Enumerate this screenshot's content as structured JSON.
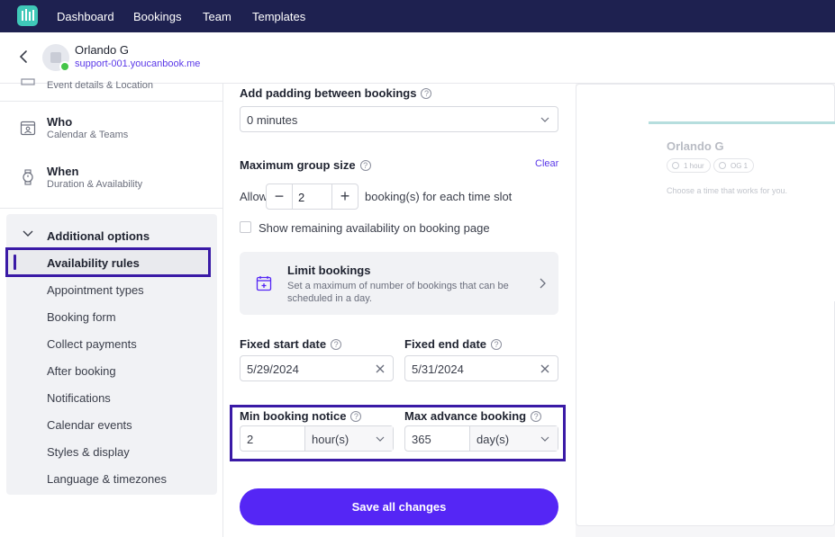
{
  "topbar": {
    "nav": [
      "Dashboard",
      "Bookings",
      "Team",
      "Templates"
    ]
  },
  "header": {
    "user_name": "Orlando G",
    "user_url": "support-001.youcanbook.me"
  },
  "sidebar": {
    "event_sub": "Event details & Location",
    "who": {
      "title": "Who",
      "sub": "Calendar & Teams"
    },
    "when": {
      "title": "When",
      "sub": "Duration & Availability"
    },
    "additional": {
      "title": "Additional options",
      "items": [
        "Availability rules",
        "Appointment types",
        "Booking form",
        "Collect payments",
        "After booking",
        "Notifications",
        "Calendar events",
        "Styles & display",
        "Language & timezones"
      ]
    }
  },
  "form": {
    "padding_label": "Add padding between bookings",
    "padding_value": "0 minutes",
    "group_label": "Maximum group size",
    "clear_label": "Clear",
    "allow_label": "Allow",
    "group_value": "2",
    "group_suffix": "booking(s) for each time slot",
    "show_remaining_label": "Show remaining availability on booking page",
    "limit_title": "Limit bookings",
    "limit_desc": "Set a maximum of number of bookings that can be scheduled in a day.",
    "start_label": "Fixed start date",
    "start_value": "5/29/2024",
    "end_label": "Fixed end date",
    "end_value": "5/31/2024",
    "min_notice_label": "Min booking notice",
    "min_notice_value": "2",
    "min_notice_unit": "hour(s)",
    "max_advance_label": "Max advance booking",
    "max_advance_value": "365",
    "max_advance_unit": "day(s)",
    "save_label": "Save all changes",
    "help_glyph": "?"
  },
  "preview": {
    "name": "Orlando G",
    "duration": "1 hour",
    "host": "OG 1",
    "subtitle": "Choose a time that works for you."
  },
  "colors": {
    "topbar": "#1e2150",
    "accent": "#5526f5",
    "highlight": "#3a1aa6",
    "link": "#5a38e8"
  }
}
